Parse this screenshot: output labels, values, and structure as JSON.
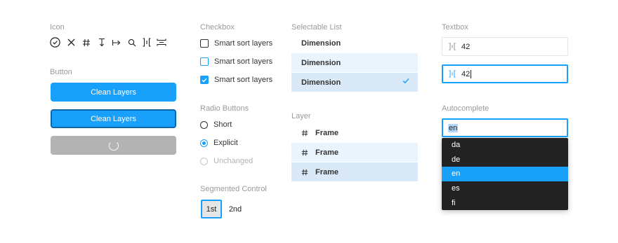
{
  "colors": {
    "accent": "#18a0fb",
    "accent_focus_border": "#0d66a8",
    "disabled": "#b3b3b3",
    "menu_bg": "#222222",
    "list_hover": "#eaf4fd",
    "list_selected": "#dae9f7"
  },
  "icons": {
    "title": "Icon",
    "items": [
      "check-circle-icon",
      "close-icon",
      "hash-icon",
      "vertical-resize-icon",
      "arrow-right-bar-icon",
      "search-icon",
      "horizontal-spacing-icon",
      "vertical-spacing-icon"
    ]
  },
  "buttons": {
    "title": "Button",
    "primary_label": "Clean Layers",
    "focused_label": "Clean Layers",
    "loading_icon": "spinner-icon"
  },
  "checkboxes": {
    "title": "Checkbox",
    "items": [
      {
        "label": "Smart sort layers",
        "state": "unchecked"
      },
      {
        "label": "Smart sort layers",
        "state": "hover"
      },
      {
        "label": "Smart sort layers",
        "state": "checked"
      }
    ]
  },
  "radios": {
    "title": "Radio Buttons",
    "items": [
      {
        "label": "Short",
        "state": "unselected"
      },
      {
        "label": "Explicit",
        "state": "selected"
      },
      {
        "label": "Unchanged",
        "state": "disabled"
      }
    ]
  },
  "segmented": {
    "title": "Segmented Control",
    "items": [
      {
        "label": "1st",
        "active": true
      },
      {
        "label": "2nd",
        "active": false
      }
    ]
  },
  "selectable_list": {
    "title": "Selectable List",
    "items": [
      {
        "label": "Dimension",
        "state": "default"
      },
      {
        "label": "Dimension",
        "state": "hover"
      },
      {
        "label": "Dimension",
        "state": "selected"
      }
    ]
  },
  "layer": {
    "title": "Layer",
    "items": [
      {
        "label": "Frame",
        "state": "default"
      },
      {
        "label": "Frame",
        "state": "hover"
      },
      {
        "label": "Frame",
        "state": "selected"
      }
    ]
  },
  "textbox": {
    "title": "Textbox",
    "items": [
      {
        "value": "42",
        "state": "default"
      },
      {
        "value": "42",
        "state": "focused"
      }
    ]
  },
  "autocomplete": {
    "title": "Autocomplete",
    "value": "en",
    "options": [
      "da",
      "de",
      "en",
      "es",
      "fi"
    ],
    "active_option": "en"
  }
}
